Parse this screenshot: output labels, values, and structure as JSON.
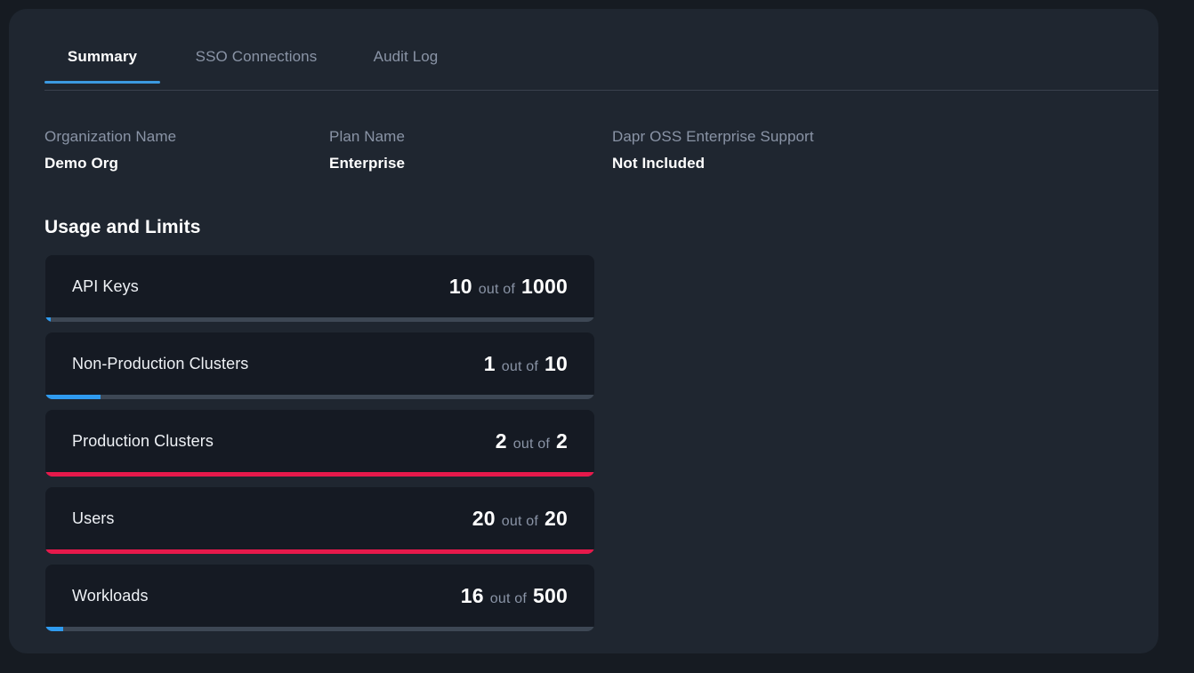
{
  "colors": {
    "page_background": "#161b22",
    "panel_background": "#1f2630",
    "card_background": "#151a23",
    "accent_blue": "#3b9ae1",
    "progress_blue": "#2f9bf0",
    "progress_full_red": "#e6194b",
    "progress_track": "#3d4754",
    "muted_text": "#8a94a6"
  },
  "tabs": [
    {
      "label": "Summary",
      "active": true
    },
    {
      "label": "SSO Connections",
      "active": false
    },
    {
      "label": "Audit Log",
      "active": false
    }
  ],
  "info": [
    {
      "label": "Organization Name",
      "value": "Demo Org"
    },
    {
      "label": "Plan Name",
      "value": "Enterprise"
    },
    {
      "label": "Dapr OSS Enterprise Support",
      "value": "Not Included"
    }
  ],
  "usage": {
    "title": "Usage and Limits",
    "separator": "out of",
    "items": [
      {
        "label": "API Keys",
        "current": "10",
        "limit": "1000",
        "percent": 1,
        "at_limit": false
      },
      {
        "label": "Non-Production Clusters",
        "current": "1",
        "limit": "10",
        "percent": 10,
        "at_limit": false
      },
      {
        "label": "Production Clusters",
        "current": "2",
        "limit": "2",
        "percent": 100,
        "at_limit": true
      },
      {
        "label": "Users",
        "current": "20",
        "limit": "20",
        "percent": 100,
        "at_limit": true
      },
      {
        "label": "Workloads",
        "current": "16",
        "limit": "500",
        "percent": 3.2,
        "at_limit": false
      }
    ]
  }
}
